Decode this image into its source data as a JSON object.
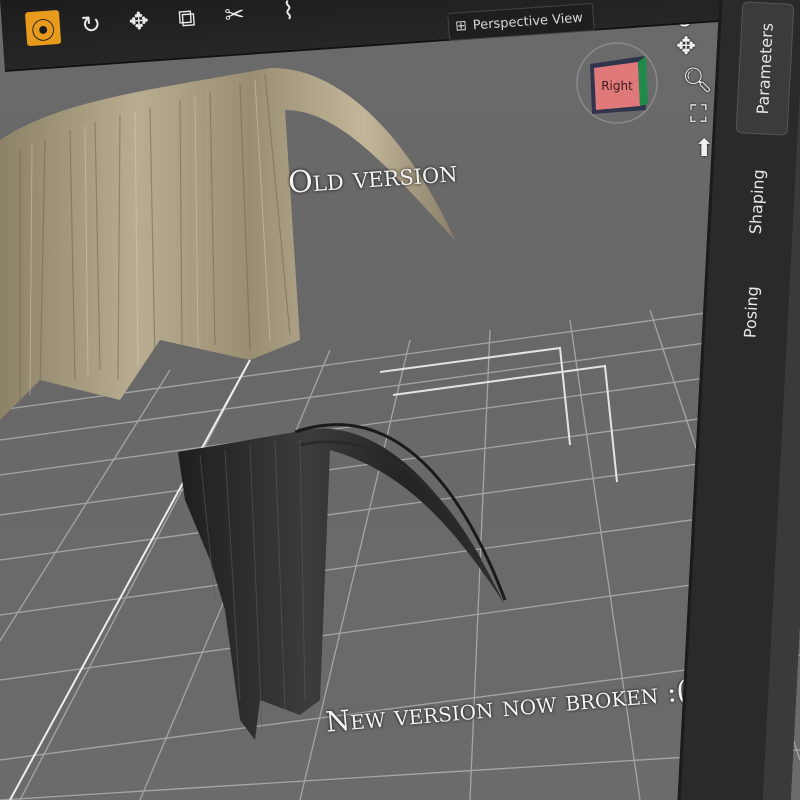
{
  "toolbar": {
    "tools": [
      {
        "name": "universal-tool-icon",
        "glyph": "⦿",
        "active": true
      },
      {
        "name": "rotate-tool-icon",
        "glyph": "↻",
        "active": false
      },
      {
        "name": "translate-tool-icon",
        "glyph": "✥",
        "active": false
      },
      {
        "name": "scale-tool-icon",
        "glyph": "⧉",
        "active": false
      },
      {
        "name": "joint-editor-icon",
        "glyph": "✂",
        "active": false
      }
    ],
    "active_color": "#e79a1c"
  },
  "viewport": {
    "view_selector_label": "Perspective View",
    "nav_cube_face": "Right",
    "nav_cube_color": "#e07a7a",
    "side_controls": [
      "orbit-icon",
      "pan-icon",
      "zoom-icon",
      "frame-icon",
      "reset-icon"
    ]
  },
  "panel": {
    "tabs": [
      "Parameters",
      "Shaping",
      "Posing"
    ]
  },
  "annotations": {
    "old_version": "Old version",
    "new_version": "New version now broken :("
  }
}
